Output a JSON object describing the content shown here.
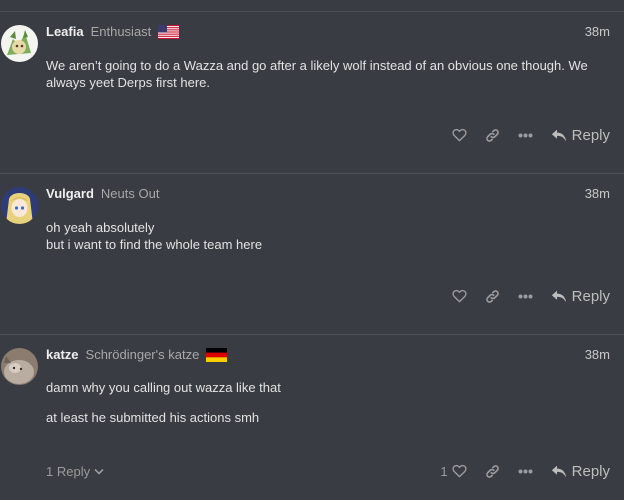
{
  "posts": [
    {
      "username": "Leafia",
      "user_title": "Enthusiast",
      "flag": "us-flag",
      "time": "38m",
      "paragraphs": [
        "We aren’t going to do a Wazza and go after a likely wolf instead of an obvious one though. We always yeet Derps first here."
      ],
      "reply_label": "Reply"
    },
    {
      "username": "Vulgard",
      "user_title": "Neuts Out",
      "time": "38m",
      "paragraphs": [
        "oh yeah absolutely",
        "but i want to find the whole team here"
      ],
      "reply_label": "Reply"
    },
    {
      "username": "katze",
      "user_title": "Schrödinger's katze",
      "flag": "de-flag",
      "time": "38m",
      "paragraphs": [
        "damn why you calling out wazza like that",
        "at least he submitted his actions smh"
      ],
      "replies_label": "1 Reply",
      "like_count": "1",
      "reply_label": "Reply"
    }
  ],
  "colors": {
    "background": "#3a3c43",
    "divider": "#4e5058",
    "muted": "#9b9b9b"
  }
}
